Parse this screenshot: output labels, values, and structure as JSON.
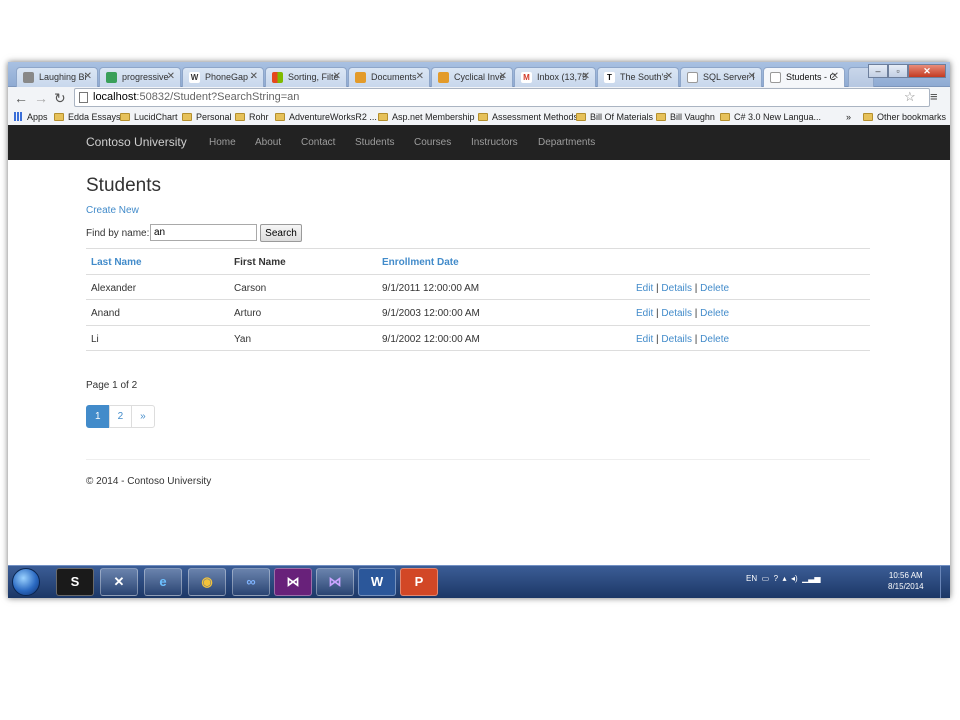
{
  "browser": {
    "tabs": [
      {
        "label": "Laughing Bi",
        "color": "#888888"
      },
      {
        "label": "progressive",
        "color": "#3aa05a"
      },
      {
        "label": "PhoneGap -",
        "color": "#555555"
      },
      {
        "label": "Sorting, Filte",
        "color": "#e06a1b"
      },
      {
        "label": "Documents",
        "color": "#e39b2a"
      },
      {
        "label": "Cyclical Inve",
        "color": "#e39b2a"
      },
      {
        "label": "Inbox (13,75",
        "color": "#d23a2a"
      },
      {
        "label": "The South's",
        "color": "#333333"
      },
      {
        "label": "SQL Server I",
        "color": "#8a8a8a"
      },
      {
        "label": "Students - C",
        "color": "#aaaaaa"
      }
    ],
    "url_host": "localhost",
    "url_path": ":50832/Student?SearchString=an",
    "bookmarks": [
      "Apps",
      "Edda Essays",
      "LucidChart",
      "Personal",
      "Rohr",
      "AdventureWorksR2 ...",
      "Asp.net Membership",
      "Assessment Methods",
      "Bill Of Materials",
      "Bill Vaughn",
      "C# 3.0 New Langua...",
      "»",
      "Other bookmarks"
    ]
  },
  "site": {
    "brand": "Contoso University",
    "nav": [
      "Home",
      "About",
      "Contact",
      "Students",
      "Courses",
      "Instructors",
      "Departments"
    ]
  },
  "page": {
    "title": "Students",
    "create_new": "Create New",
    "find_label": "Find by name:",
    "search_value": "an",
    "search_button": "Search",
    "columns": {
      "last_name": "Last Name",
      "first_name": "First Name",
      "enrollment_date": "Enrollment Date"
    },
    "rows": [
      {
        "last": "Alexander",
        "first": "Carson",
        "date": "9/1/2011 12:00:00 AM"
      },
      {
        "last": "Anand",
        "first": "Arturo",
        "date": "9/1/2003 12:00:00 AM"
      },
      {
        "last": "Li",
        "first": "Yan",
        "date": "9/1/2002 12:00:00 AM"
      }
    ],
    "actions": {
      "edit": "Edit",
      "details": "Details",
      "delete": "Delete",
      "sep": "|"
    },
    "page_count": "Page 1 of 2",
    "pagination": [
      "1",
      "2",
      "»"
    ],
    "footer": "© 2014 - Contoso University"
  },
  "taskbar": {
    "apps": [
      "S",
      "✕",
      "e",
      "◉",
      "∞",
      "⋈",
      "⋈",
      "W",
      "P"
    ],
    "tray_lang": "EN",
    "time": "10:56 AM",
    "date": "8/15/2014"
  },
  "colors": {
    "link": "#428bca",
    "navbar": "#222222",
    "active_page": "#428bca"
  }
}
